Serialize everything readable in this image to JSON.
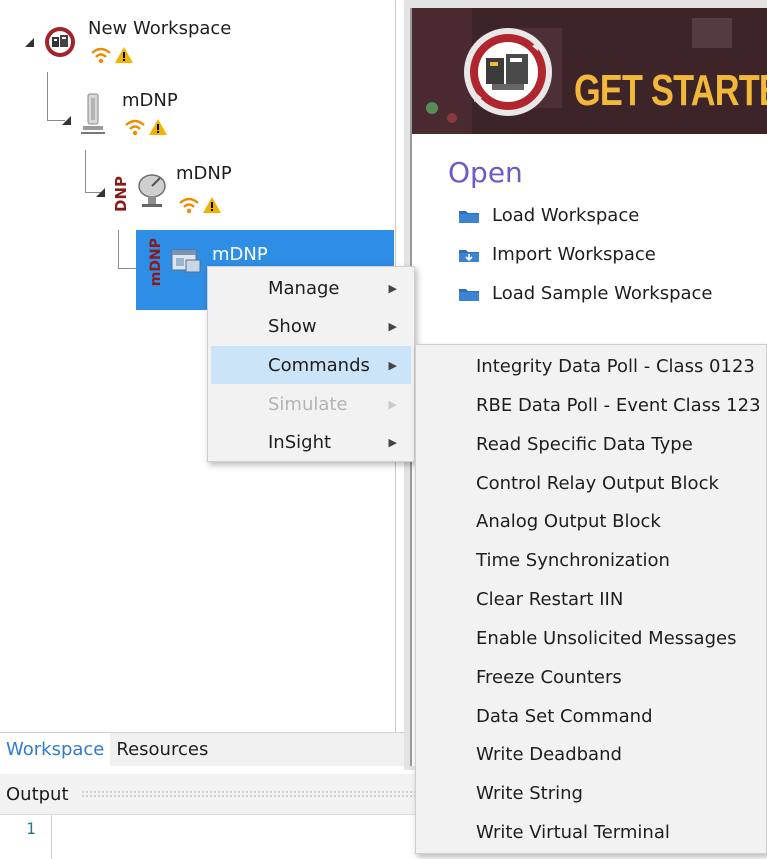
{
  "tree": {
    "root": {
      "label": "New Workspace"
    },
    "child1": {
      "label": "mDNP"
    },
    "child2": {
      "label": "mDNP",
      "tag": "DNP"
    },
    "child3": {
      "label": "mDNP",
      "tag": "mDNP",
      "selected": true
    }
  },
  "start_page": {
    "banner_title": "GET STARTED",
    "open_heading": "Open",
    "links": [
      "Load Workspace",
      "Import Workspace",
      "Load Sample Workspace"
    ]
  },
  "bottom_tabs": [
    "Workspace",
    "Resources"
  ],
  "output": {
    "title": "Output",
    "line_number": "1"
  },
  "context_menu": {
    "items": [
      {
        "label": "Manage",
        "state": "normal"
      },
      {
        "label": "Show",
        "state": "normal"
      },
      {
        "label": "Commands",
        "state": "highlighted"
      },
      {
        "label": "Simulate",
        "state": "disabled"
      },
      {
        "label": "InSight",
        "state": "normal"
      }
    ]
  },
  "commands_submenu": {
    "items": [
      "Integrity Data Poll - Class 0123",
      "RBE Data Poll - Event Class 123",
      "Read Specific Data Type",
      "Control Relay Output Block",
      "Analog Output Block",
      "Time Synchronization",
      "Clear Restart IIN",
      "Enable Unsolicited Messages",
      "Freeze Counters",
      "Data Set Command",
      "Write Deadband",
      "Write String",
      "Write Virtual Terminal"
    ]
  },
  "colors": {
    "selection": "#2e8de4",
    "menu_highlight": "#cce4f7",
    "open_heading": "#7058c8",
    "banner_text": "#f2b83a",
    "warning": "#f0b400",
    "signal": "#f08a00"
  }
}
